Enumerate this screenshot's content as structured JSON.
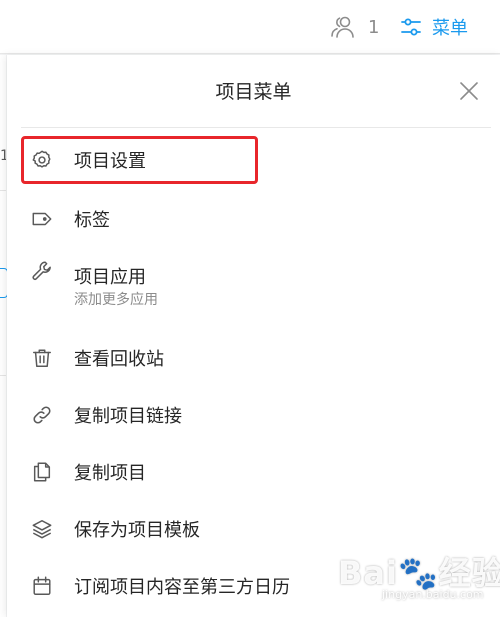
{
  "topbar": {
    "member_count": "1",
    "menu_label": "菜单"
  },
  "background": {
    "partial_digit": "1"
  },
  "panel": {
    "title": "项目菜单",
    "items": [
      {
        "label": "项目设置",
        "icon": "gear-icon",
        "highlighted": true
      },
      {
        "label": "标签",
        "icon": "tag-icon"
      },
      {
        "label": "项目应用",
        "sub": "添加更多应用",
        "icon": "wrench-icon"
      },
      {
        "label": "查看回收站",
        "icon": "trash-icon"
      },
      {
        "label": "复制项目链接",
        "icon": "link-icon"
      },
      {
        "label": "复制项目",
        "icon": "copy-icon"
      },
      {
        "label": "保存为项目模板",
        "icon": "layers-icon"
      },
      {
        "label": "订阅项目内容至第三方日历",
        "icon": "calendar-icon"
      }
    ]
  },
  "watermark": {
    "text": "Bai🐾经验",
    "url": "jingyan.baidu.com"
  },
  "colors": {
    "accent": "#1b9aee",
    "highlight_border": "#e8262b",
    "text": "#262626",
    "muted": "#8c8c8c"
  }
}
